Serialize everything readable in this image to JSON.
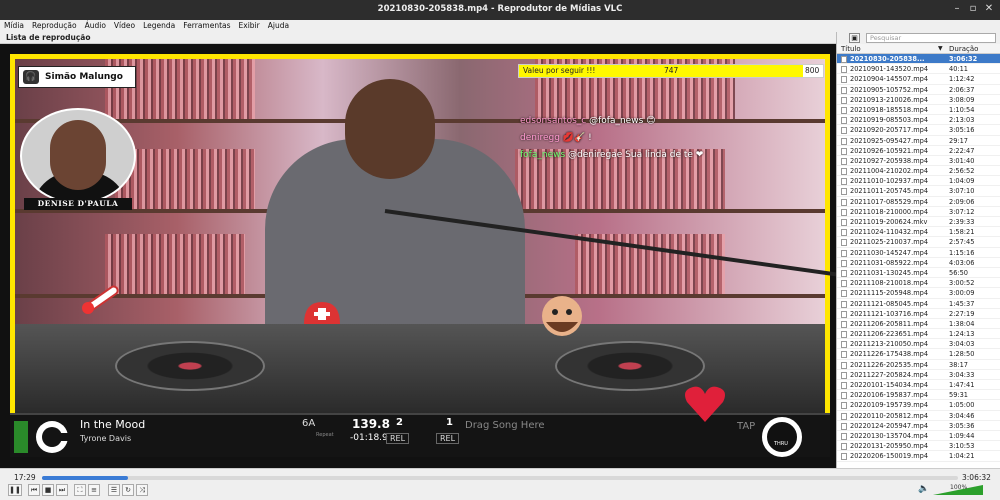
{
  "window": {
    "title": "20210830-205838.mp4 - Reprodutor de Mídias VLC"
  },
  "menu": [
    "Mídia",
    "Reprodução",
    "Áudio",
    "Vídeo",
    "Legenda",
    "Ferramentas",
    "Exibir",
    "Ajuda"
  ],
  "playlist_label": "Lista de reprodução",
  "overlay": {
    "host_name": "Simão Malungo",
    "webcam_label": "DENISE D'PAULA",
    "goal": {
      "text": "Valeu por seguir !!!",
      "current": "747",
      "target": "800",
      "progress": 0.934
    },
    "chat": [
      {
        "user": "edsonsantos_c",
        "text": "@fofa_news 😊"
      },
      {
        "user": "deniregg",
        "text": "💋🎸 !"
      },
      {
        "user": "fofa_news",
        "text": "@deniregae Sua linda de te ❤"
      }
    ],
    "accent_color": "#ffe600"
  },
  "deck": {
    "song": "In the Mood",
    "artist": "Tyrone Davis",
    "key": "6A",
    "bpm": "139.8",
    "repeat_label": "Repeat",
    "remaining": "-01:18.9",
    "beat_a": "2",
    "rel_a": "REL",
    "beat_b": "1",
    "rel_b": "REL",
    "drag_hint": "Drag Song Here",
    "tap": "TAP",
    "thru": "THRU"
  },
  "controls": {
    "elapsed": "17:29",
    "total": "3:06:32",
    "progress": 0.094,
    "volume_label": "100%",
    "volume": 1.0
  },
  "sidebar": {
    "search_placeholder": "Pesquisar",
    "col_title": "Título",
    "col_duration": "Duração",
    "rows": [
      [
        "20210830-205838...",
        "3:06:32"
      ],
      [
        "20210901-143520.mp4",
        "40:11"
      ],
      [
        "20210904-145507.mp4",
        "1:12:42"
      ],
      [
        "20210905-105752.mp4",
        "2:06:37"
      ],
      [
        "20210913-210026.mp4",
        "3:08:09"
      ],
      [
        "20210918-185518.mp4",
        "1:10:54"
      ],
      [
        "20210919-085503.mp4",
        "2:13:03"
      ],
      [
        "20210920-205717.mp4",
        "3:05:16"
      ],
      [
        "20210925-095427.mp4",
        "29:17"
      ],
      [
        "20210926-105921.mp4",
        "2:22:47"
      ],
      [
        "20210927-205938.mp4",
        "3:01:40"
      ],
      [
        "20211004-210202.mp4",
        "2:56:52"
      ],
      [
        "20211010-102937.mp4",
        "1:04:09"
      ],
      [
        "20211011-205745.mp4",
        "3:07:10"
      ],
      [
        "20211017-085529.mp4",
        "2:09:06"
      ],
      [
        "20211018-210000.mp4",
        "3:07:12"
      ],
      [
        "20211019-200624.mkv",
        "2:39:33"
      ],
      [
        "20211024-110432.mp4",
        "1:58:21"
      ],
      [
        "20211025-210037.mp4",
        "2:57:45"
      ],
      [
        "20211030-145247.mp4",
        "1:15:16"
      ],
      [
        "20211031-085922.mp4",
        "4:03:06"
      ],
      [
        "20211031-130245.mp4",
        "56:50"
      ],
      [
        "20211108-210018.mp4",
        "3:00:52"
      ],
      [
        "20211115-205948.mp4",
        "3:00:09"
      ],
      [
        "20211121-085045.mp4",
        "1:45:37"
      ],
      [
        "20211121-103716.mp4",
        "2:27:19"
      ],
      [
        "20211206-205811.mp4",
        "1:38:04"
      ],
      [
        "20211206-223651.mp4",
        "1:24:13"
      ],
      [
        "20211213-210050.mp4",
        "3:04:03"
      ],
      [
        "20211226-175438.mp4",
        "1:28:50"
      ],
      [
        "20211226-202535.mp4",
        "38:17"
      ],
      [
        "20211227-205824.mp4",
        "3:04:33"
      ],
      [
        "20220101-154034.mp4",
        "1:47:41"
      ],
      [
        "20220106-195837.mp4",
        "59:31"
      ],
      [
        "20220109-195739.mp4",
        "1:05:00"
      ],
      [
        "20220110-205812.mp4",
        "3:04:46"
      ],
      [
        "20220124-205947.mp4",
        "3:05:36"
      ],
      [
        "20220130-135704.mp4",
        "1:09:44"
      ],
      [
        "20220131-205950.mp4",
        "3:10:53"
      ],
      [
        "20220206-150019.mp4",
        "1:04:21"
      ]
    ]
  }
}
